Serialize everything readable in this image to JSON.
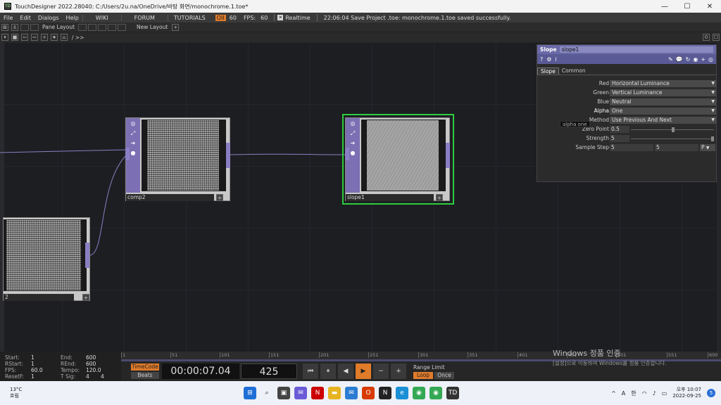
{
  "window": {
    "title": "TouchDesigner 2022.28040: C:/Users/2u.na/OneDrive/바탕 화면/monochrome.1.toe*",
    "minimize": "—",
    "maximize": "☐",
    "close": "✕"
  },
  "menu": {
    "items": [
      "File",
      "Edit",
      "Dialogs",
      "Help"
    ],
    "wiki": "WIKI",
    "forum": "FORUM",
    "tutorials": "TUTORIALS",
    "oii": "OII",
    "fps_target": "60",
    "fps_label": "FPS:",
    "fps_value": "60",
    "realtime": "Realtime",
    "status": "22:06:04 Save Project .toe: monochrome.1.toe saved successfully."
  },
  "toolbar": {
    "pane_layout": "Pane Layout",
    "new_layout": "New Layout",
    "plus": "+",
    "counter": "0",
    "path": "/ >>"
  },
  "nodes": {
    "comp": {
      "label": "comp2"
    },
    "slope": {
      "label": "slope1"
    },
    "left": {
      "label": "2"
    }
  },
  "panel": {
    "type": "Slope",
    "name": "slope1",
    "tabs": [
      "Slope",
      "Common"
    ],
    "params": [
      {
        "label": "Red",
        "value": "Horizontal Luminance"
      },
      {
        "label": "Green",
        "value": "Vertical Luminance"
      },
      {
        "label": "Blue",
        "value": "Neutral"
      },
      {
        "label": "Alpha",
        "value": "One"
      },
      {
        "label": "Method",
        "value": "Use Previous And Next"
      }
    ],
    "zero_point": {
      "label": "Zero Point",
      "value": "0.5"
    },
    "strength": {
      "label": "Strength",
      "value": "5"
    },
    "sample_step": {
      "label": "Sample Step",
      "value1": "5",
      "value2": "5",
      "mode": "P"
    },
    "tooltip": "alpha  one",
    "plus": "+"
  },
  "timeline": {
    "start": "1",
    "end": "600",
    "rstart": "1",
    "rend": "600",
    "fps": "60.0",
    "tempo": "120.0",
    "resetf": "1",
    "tsig1": "4",
    "tsig2": "4",
    "labels": {
      "start": "Start:",
      "end": "End:",
      "rstart": "RStart:",
      "rend": "REnd:",
      "fps": "FPS:",
      "tempo": "Tempo:",
      "resetf": "ResetF:",
      "tsig": "T Sig:"
    },
    "ticks": [
      "1",
      "51",
      "101",
      "151",
      "201",
      "251",
      "301",
      "351",
      "401",
      "451",
      "501",
      "551",
      "600"
    ],
    "timecode_btn": "TimeCode",
    "beats_btn": "Beats",
    "timecode": "00:00:07.04",
    "frame": "425",
    "range_limit": "Range Limit",
    "loop": "Loop",
    "once": "Once"
  },
  "watermark": {
    "line1": "Windows 정품 인증",
    "line2": "[설정]으로 이동하여 Windows를 정품 인증합니다."
  },
  "taskbar": {
    "temp": "13°C",
    "weather": "흐림",
    "ime1": "A",
    "ime2": "한",
    "time": "오후 10:07",
    "date": "2022-09-25",
    "badge": "5"
  }
}
